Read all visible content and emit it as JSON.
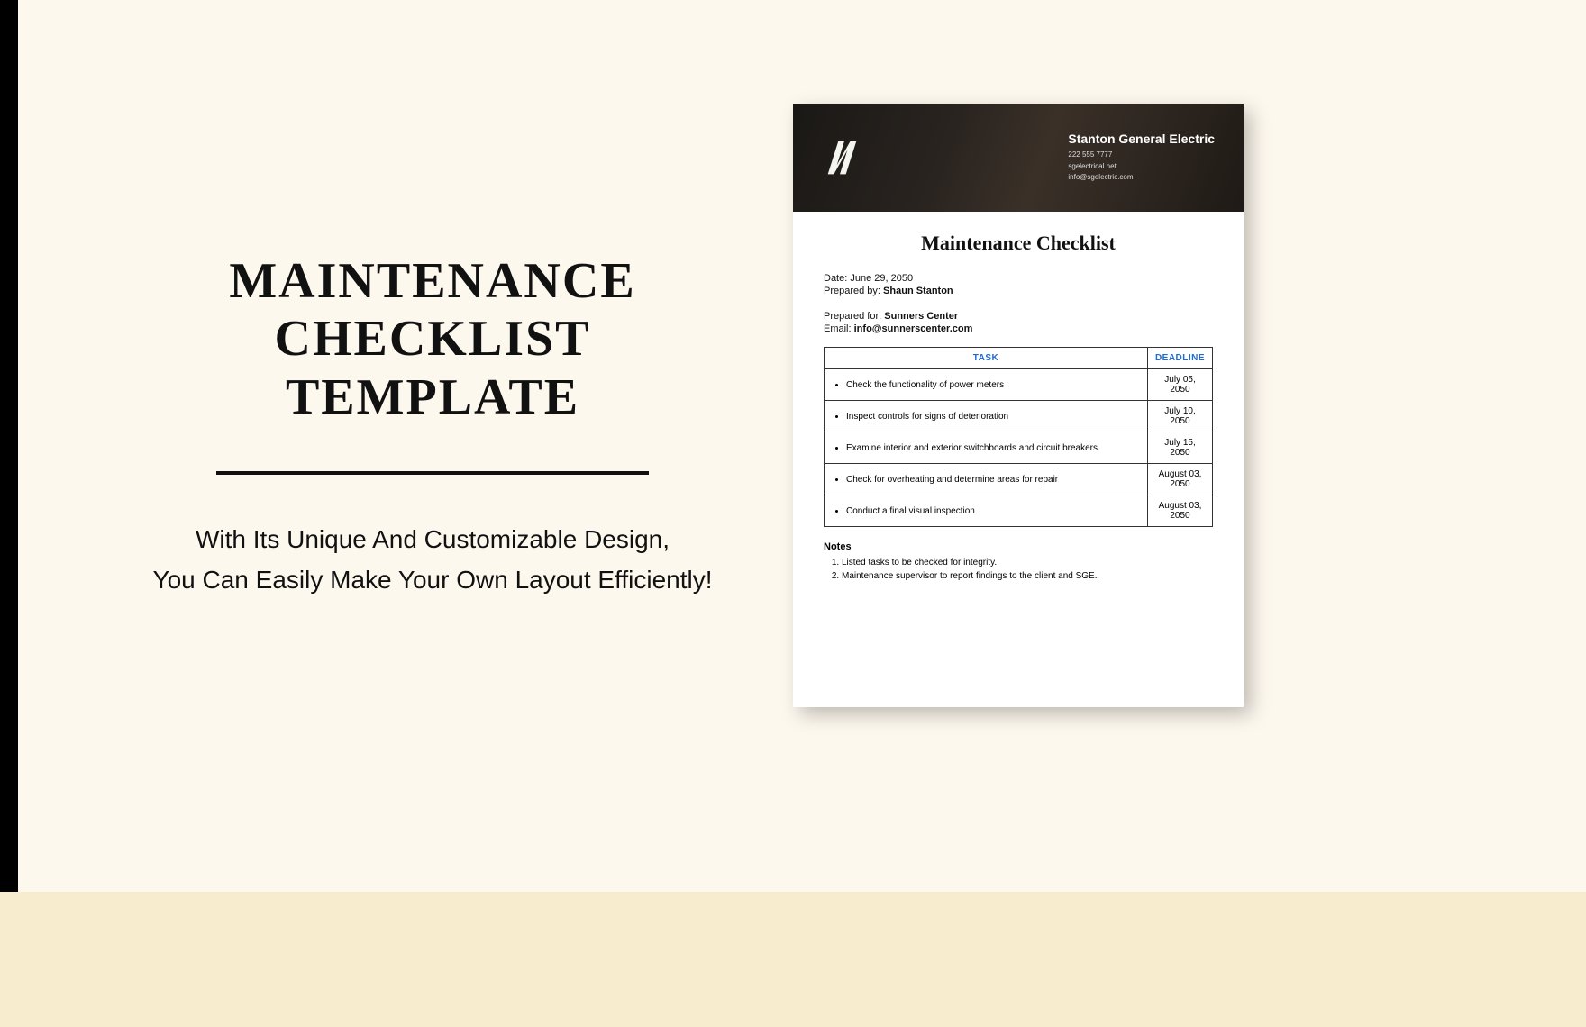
{
  "left": {
    "title_line1": "MAINTENANCE CHECKLIST",
    "title_line2": "TEMPLATE",
    "subtitle_line1": "With Its Unique And Customizable Design,",
    "subtitle_line2": "You Can Easily Make Your Own Layout Efficiently!"
  },
  "doc": {
    "company": {
      "name": "Stanton General Electric",
      "phone": "222 555 7777",
      "website": "sgelectrical.net",
      "email": "info@sgelectric.com"
    },
    "title": "Maintenance Checklist",
    "meta": {
      "date_label": "Date:",
      "date_value": "June 29, 2050",
      "prepared_by_label": "Prepared by:",
      "prepared_by_value": "Shaun Stanton",
      "prepared_for_label": "Prepared for:",
      "prepared_for_value": "Sunners Center",
      "email_label": "Email:",
      "email_value": "info@sunnerscenter.com"
    },
    "table": {
      "headers": {
        "task": "TASK",
        "deadline": "DEADLINE"
      },
      "rows": [
        {
          "task": "Check the functionality of power meters",
          "deadline": "July 05, 2050"
        },
        {
          "task": "Inspect controls for signs of deterioration",
          "deadline": "July 10, 2050"
        },
        {
          "task": "Examine interior and exterior switchboards and circuit breakers",
          "deadline": "July 15, 2050"
        },
        {
          "task": "Check for overheating and determine areas for repair",
          "deadline": "August 03, 2050"
        },
        {
          "task": "Conduct a final visual inspection",
          "deadline": "August 03, 2050"
        }
      ]
    },
    "notes": {
      "title": "Notes",
      "items": [
        "Listed tasks to be checked for integrity.",
        "Maintenance supervisor to report findings to the client and SGE."
      ]
    }
  }
}
